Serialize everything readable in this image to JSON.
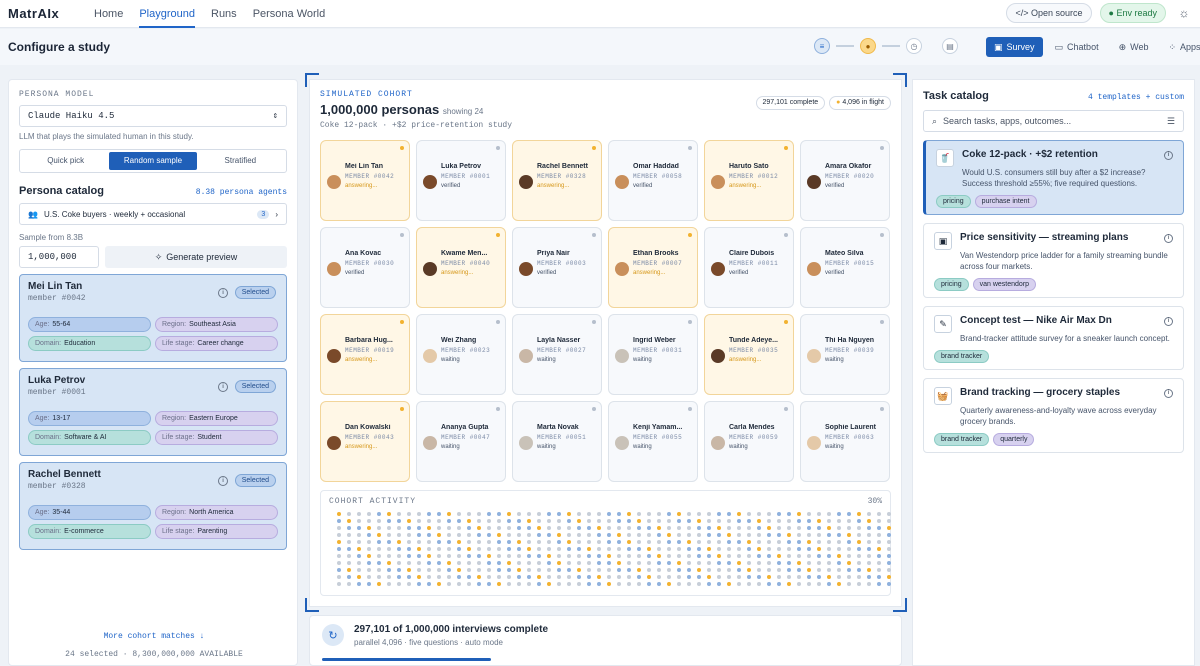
{
  "nav": {
    "logo": "MatrAIx",
    "links": [
      "Home",
      "Playground",
      "Runs",
      "Persona World"
    ],
    "active": "Playground",
    "open_source": "Open source",
    "env_ready": "Env ready"
  },
  "study": {
    "title": "Configure a study",
    "modes": [
      "Survey",
      "Chatbot",
      "Web",
      "Apps"
    ],
    "active_mode": "Survey"
  },
  "left": {
    "persona_model_label": "PERSONA MODEL",
    "model": "Claude Haiku 4.5",
    "model_hint": "LLM that plays the simulated human in this study.",
    "seg": [
      "Quick pick",
      "Random sample",
      "Stratified"
    ],
    "catalog_title": "Persona catalog",
    "catalog_count": "8.38 persona agents",
    "filter": "U.S. Coke buyers · weekly + occasional",
    "filter_count": "3",
    "sample_label": "Sample from 8.3B",
    "sample_value": "1,000,000",
    "generate": "Generate preview",
    "cards": [
      {
        "name": "Mei Lin Tan",
        "member": "member #0042",
        "selected": "Selected",
        "age": "55-64",
        "region": "Southeast Asia",
        "domain": "Education",
        "life": "Career change"
      },
      {
        "name": "Luka Petrov",
        "member": "member #0001",
        "selected": "Selected",
        "age": "13-17",
        "region": "Eastern Europe",
        "domain": "Software & AI",
        "life": "Student"
      },
      {
        "name": "Rachel Bennett",
        "member": "member #0328",
        "selected": "Selected",
        "age": "35-44",
        "region": "North America",
        "domain": "E-commerce",
        "life": "Parenting"
      }
    ],
    "labels": {
      "age": "Age:",
      "region": "Region:",
      "domain": "Domain:",
      "life": "Life stage:"
    },
    "more": "More cohort matches ↓",
    "footer": "24 selected · 8,300,000,000 AVAILABLE"
  },
  "center": {
    "label": "SIMULATED COHORT",
    "title": "1,000,000 personas",
    "showing": "showing 24",
    "subtitle": "Coke 12-pack · +$2 price-retention study",
    "complete": "297,101 complete",
    "inflight": "4,096 in flight",
    "members": [
      {
        "name": "Mei Lin Tan",
        "id": "MEMBER #0042",
        "status": "answering...",
        "ans": true,
        "skin": "#c98f5b"
      },
      {
        "name": "Luka Petrov",
        "id": "MEMBER #0001",
        "status": "verified",
        "ans": false,
        "skin": "#7a4a2a"
      },
      {
        "name": "Rachel Bennett",
        "id": "MEMBER #0328",
        "status": "answering...",
        "ans": true,
        "skin": "#5a3a26"
      },
      {
        "name": "Omar Haddad",
        "id": "MEMBER #0058",
        "status": "verified",
        "ans": false,
        "skin": "#c98f5b"
      },
      {
        "name": "Haruto Sato",
        "id": "MEMBER #0012",
        "status": "answering...",
        "ans": true,
        "skin": "#c98f5b"
      },
      {
        "name": "Amara Okafor",
        "id": "MEMBER #0020",
        "status": "verified",
        "ans": false,
        "skin": "#5a3a26"
      },
      {
        "name": "Ana Kovac",
        "id": "MEMBER #0030",
        "status": "verified",
        "ans": false,
        "skin": "#c98f5b"
      },
      {
        "name": "Kwame Men...",
        "id": "MEMBER #0040",
        "status": "answering...",
        "ans": true,
        "skin": "#5a3a26"
      },
      {
        "name": "Priya Nair",
        "id": "MEMBER #0003",
        "status": "verified",
        "ans": false,
        "skin": "#7a4a2a"
      },
      {
        "name": "Ethan Brooks",
        "id": "MEMBER #0007",
        "status": "answering...",
        "ans": true,
        "skin": "#c98f5b"
      },
      {
        "name": "Claire Dubois",
        "id": "MEMBER #0011",
        "status": "verified",
        "ans": false,
        "skin": "#7a4a2a"
      },
      {
        "name": "Mateo Silva",
        "id": "MEMBER #0015",
        "status": "verified",
        "ans": false,
        "skin": "#c98f5b"
      },
      {
        "name": "Barbara Hug...",
        "id": "MEMBER #0019",
        "status": "answering...",
        "ans": true,
        "skin": "#7a4a2a"
      },
      {
        "name": "Wei Zhang",
        "id": "MEMBER #0023",
        "status": "waiting",
        "ans": false,
        "skin": "#e4c9a8"
      },
      {
        "name": "Layla Nasser",
        "id": "MEMBER #0027",
        "status": "waiting",
        "ans": false,
        "skin": "#c9b7a6"
      },
      {
        "name": "Ingrid Weber",
        "id": "MEMBER #0031",
        "status": "waiting",
        "ans": false,
        "skin": "#c9c2b8"
      },
      {
        "name": "Tunde Adeye...",
        "id": "MEMBER #0035",
        "status": "answering...",
        "ans": true,
        "skin": "#5a3a26"
      },
      {
        "name": "Thi Ha Nguyen",
        "id": "MEMBER #0039",
        "status": "waiting",
        "ans": false,
        "skin": "#e4c9a8"
      },
      {
        "name": "Dan Kowalski",
        "id": "MEMBER #0043",
        "status": "answering...",
        "ans": true,
        "skin": "#7a4a2a"
      },
      {
        "name": "Ananya Gupta",
        "id": "MEMBER #0047",
        "status": "waiting",
        "ans": false,
        "skin": "#c9b7a6"
      },
      {
        "name": "Marta Novak",
        "id": "MEMBER #0051",
        "status": "waiting",
        "ans": false,
        "skin": "#c9c2b8"
      },
      {
        "name": "Kenji Yamam...",
        "id": "MEMBER #0055",
        "status": "waiting",
        "ans": false,
        "skin": "#c9c2b8"
      },
      {
        "name": "Carla Mendes",
        "id": "MEMBER #0059",
        "status": "waiting",
        "ans": false,
        "skin": "#c9b7a6"
      },
      {
        "name": "Sophie Laurent",
        "id": "MEMBER #0063",
        "status": "waiting",
        "ans": false,
        "skin": "#e4c9a8"
      }
    ],
    "activity_label": "COHORT ACTIVITY",
    "activity_pct": "30%",
    "progress_title": "297,101 of 1,000,000 interviews complete",
    "progress_sub": "parallel 4,096 · five questions · auto mode",
    "progress_fraction": 0.297
  },
  "right": {
    "title": "Task catalog",
    "count": "4 templates + custom",
    "search_placeholder": "Search tasks, apps, outcomes...",
    "tasks": [
      {
        "title": "Coke 12-pack · +$2 retention",
        "desc": "Would U.S. consumers still buy after a $2 increase? Success threshold ≥55%; five required questions.",
        "tags": [
          {
            "t": "pricing",
            "c": "teal"
          },
          {
            "t": "purchase intent",
            "c": "purple"
          }
        ],
        "icon": "cart-icon",
        "glyph": "🥤"
      },
      {
        "title": "Price sensitivity — streaming plans",
        "desc": "Van Westendorp price ladder for a family streaming bundle across four markets.",
        "tags": [
          {
            "t": "pricing",
            "c": "teal"
          },
          {
            "t": "van westendorp",
            "c": "purple"
          }
        ],
        "icon": "tv-icon",
        "glyph": "▣"
      },
      {
        "title": "Concept test — Nike Air Max Dn",
        "desc": "Brand-tracker attitude survey for a sneaker launch concept.",
        "tags": [
          {
            "t": "brand tracker",
            "c": "teal"
          }
        ],
        "icon": "shoe-icon",
        "glyph": "✎"
      },
      {
        "title": "Brand tracking — grocery staples",
        "desc": "Quarterly awareness-and-loyalty wave across everyday grocery brands.",
        "tags": [
          {
            "t": "brand tracker",
            "c": "teal"
          },
          {
            "t": "quarterly",
            "c": "purple"
          }
        ],
        "icon": "basket-icon",
        "glyph": "🧺"
      }
    ]
  },
  "colors": {
    "accent": "#1f5fb8",
    "answering": "#f2b230",
    "dot_blue": "#8fb1dd",
    "dot_gray": "#c7ced8"
  }
}
